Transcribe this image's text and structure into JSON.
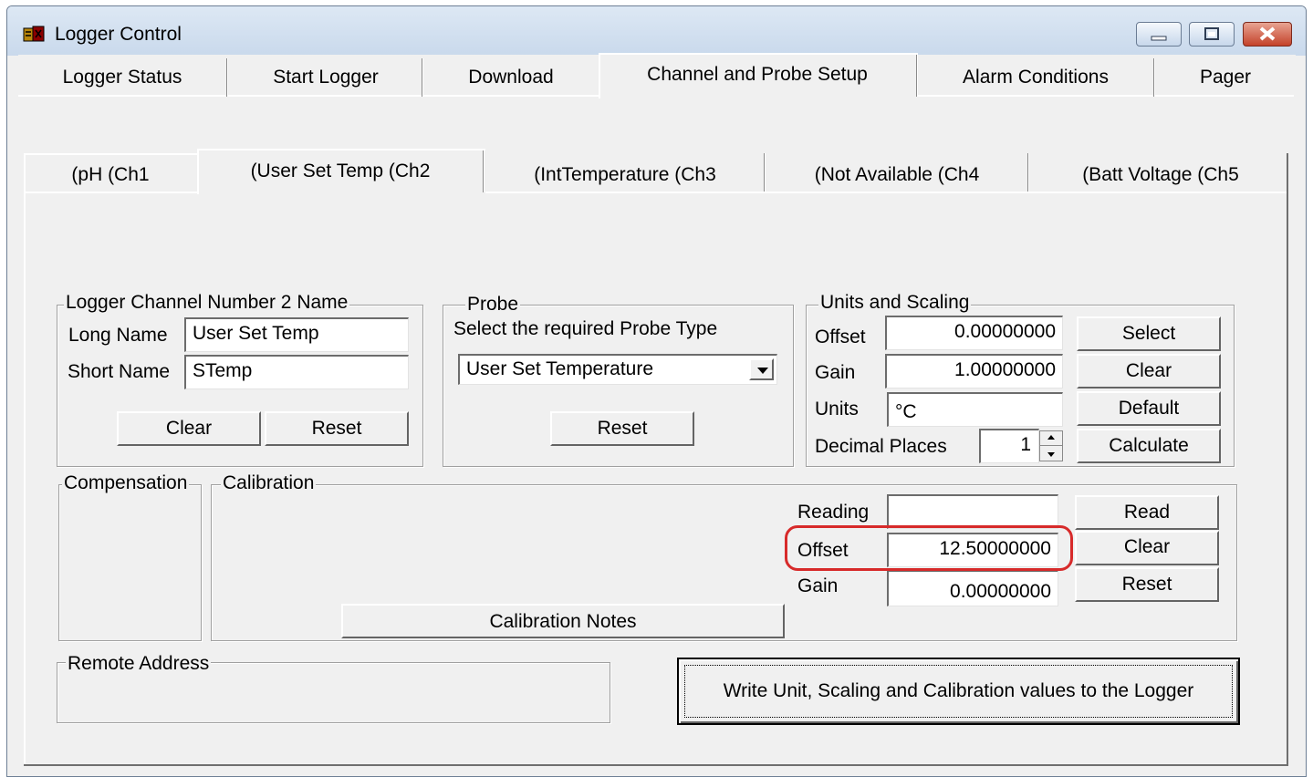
{
  "window": {
    "title": "Logger Control"
  },
  "main_tabs": [
    "Logger Status",
    "Start Logger",
    "Download",
    "Channel and Probe Setup",
    "Alarm Conditions",
    "Pager"
  ],
  "channel_tabs": [
    "(pH (Ch1",
    "(User Set Temp (Ch2",
    "(IntTemperature (Ch3",
    "(Not Available (Ch4",
    "(Batt Voltage (Ch5"
  ],
  "channel_name": {
    "group": "Logger Channel Number 2 Name",
    "long_label": "Long Name",
    "long_value": "User Set Temp",
    "short_label": "Short Name",
    "short_value": "STemp",
    "clear": "Clear",
    "reset": "Reset"
  },
  "probe": {
    "group": "Probe",
    "instruction": "Select the required Probe Type",
    "selected": "User Set Temperature",
    "reset": "Reset"
  },
  "units": {
    "group": "Units and Scaling",
    "offset_label": "Offset",
    "offset_value": "0.00000000",
    "gain_label": "Gain",
    "gain_value": "1.00000000",
    "units_label": "Units",
    "units_value": "°C",
    "decimal_label": "Decimal Places",
    "decimal_value": "1",
    "select": "Select",
    "clear": "Clear",
    "default": "Default",
    "calculate": "Calculate"
  },
  "compensation": {
    "group": "Compensation"
  },
  "calibration": {
    "group": "Calibration",
    "reading_label": "Reading",
    "reading_value": "",
    "offset_label": "Offset",
    "offset_value": "12.50000000",
    "gain_label": "Gain",
    "gain_value": "0.00000000",
    "read": "Read",
    "clear": "Clear",
    "reset": "Reset",
    "notes": "Calibration Notes"
  },
  "remote": {
    "group": "Remote Address"
  },
  "write_button": "Write Unit, Scaling and Calibration values to the Logger",
  "colors": {
    "highlight": "#d72a2a",
    "titlebar": "#c9d9ec",
    "close": "#c4422a"
  }
}
